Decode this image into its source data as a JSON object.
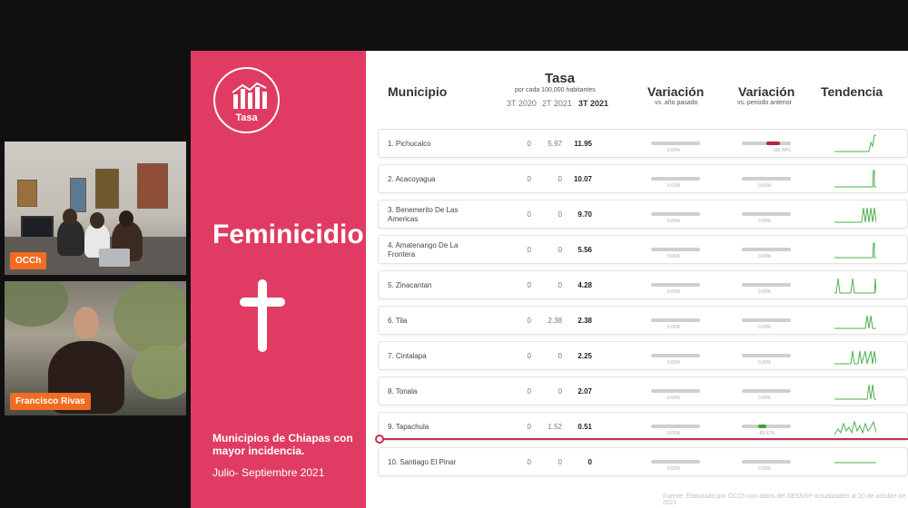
{
  "participants": [
    {
      "name": "OCCh"
    },
    {
      "name": "Francisco Rivas"
    }
  ],
  "slide": {
    "logo_label": "Tasa",
    "title": "Feminicidio",
    "subtitle": "Municipios de Chiapas con mayor incidencia.",
    "period": "Julio- Septiembre 2021",
    "headers": {
      "municipio": "Municipio",
      "tasa": "Tasa",
      "tasa_sub": "por cada 100,000 habitantes",
      "col1": "3T 2020",
      "col2": "2T 2021",
      "col3": "3T 2021",
      "var1": "Variación",
      "var1_sub": "vs. año pasado",
      "var2": "Variación",
      "var2_sub": "vs. periodo anterior",
      "trend": "Tendencia"
    },
    "rows": [
      {
        "name": "1. Pichucalco",
        "v1": "0",
        "v2": "5.97",
        "v3": "11.95",
        "var1": "0.00%",
        "var2": "100.00%",
        "var2_color": "#b3283e",
        "var2_fill": 0.55
      },
      {
        "name": "2. Acacoyagua",
        "v1": "0",
        "v2": "0",
        "v3": "10.07",
        "var1": "0.00%",
        "var2": "0.00%"
      },
      {
        "name": "3. Benemerito De Las Americas",
        "v1": "0",
        "v2": "0",
        "v3": "9.70",
        "var1": "0.00%",
        "var2": "0.00%"
      },
      {
        "name": "4. Amatenango De La Frontera",
        "v1": "0",
        "v2": "0",
        "v3": "5.56",
        "var1": "0.00%",
        "var2": "0.00%"
      },
      {
        "name": "5. Zinacantan",
        "v1": "0",
        "v2": "0",
        "v3": "4.28",
        "var1": "0.00%",
        "var2": "0.00%"
      },
      {
        "name": "6. Tila",
        "v1": "0",
        "v2": "2.38",
        "v3": "2.38",
        "var1": "0.00%",
        "var2": "0.00%"
      },
      {
        "name": "7. Cintalapa",
        "v1": "0",
        "v2": "0",
        "v3": "2.25",
        "var1": "0.00%",
        "var2": "0.00%"
      },
      {
        "name": "8. Tonala",
        "v1": "0",
        "v2": "0",
        "v3": "2.07",
        "var1": "0.00%",
        "var2": "0.00%"
      },
      {
        "name": "9. Tapachula",
        "v1": "0",
        "v2": "1.52",
        "v3": "0.51",
        "var1": "0.00%",
        "var2": "-66.67%",
        "var2_color": "#3aa33a",
        "var2_fill": 0.35
      },
      {
        "name": "10. Santiago El Pinar",
        "v1": "0",
        "v2": "0",
        "v3": "0",
        "var1": "0.00%",
        "var2": "0.00%"
      }
    ],
    "footer": "Fuente: Elaborado por OCCh con datos del SESNSP actualizados al 20 de octubre de 2021"
  },
  "colors": {
    "pink": "#e03c63",
    "divider": "#c7304f",
    "spark": "#4caf50"
  }
}
